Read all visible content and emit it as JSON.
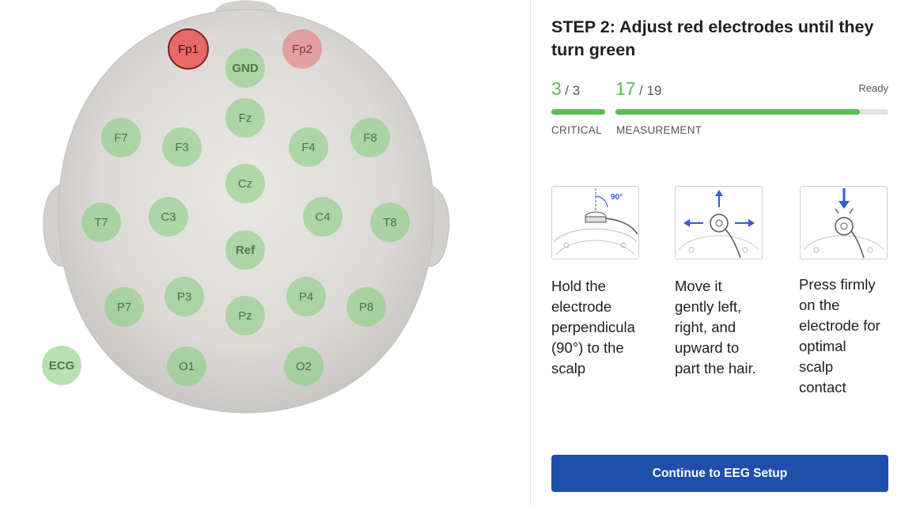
{
  "head_map": {
    "electrodes": [
      {
        "label": "Fp1",
        "state": "red",
        "bold": false
      },
      {
        "label": "Fp2",
        "state": "pink",
        "bold": false
      },
      {
        "label": "GND",
        "state": "green",
        "bold": true
      },
      {
        "label": "Fz",
        "state": "green",
        "bold": false
      },
      {
        "label": "F7",
        "state": "green",
        "bold": false
      },
      {
        "label": "F3",
        "state": "green",
        "bold": false
      },
      {
        "label": "F4",
        "state": "green",
        "bold": false
      },
      {
        "label": "F8",
        "state": "green",
        "bold": false
      },
      {
        "label": "Cz",
        "state": "green",
        "bold": false
      },
      {
        "label": "T7",
        "state": "green",
        "bold": false
      },
      {
        "label": "C3",
        "state": "green",
        "bold": false
      },
      {
        "label": "C4",
        "state": "green",
        "bold": false
      },
      {
        "label": "T8",
        "state": "green",
        "bold": false
      },
      {
        "label": "Ref",
        "state": "green",
        "bold": true
      },
      {
        "label": "P7",
        "state": "green",
        "bold": false
      },
      {
        "label": "P3",
        "state": "green",
        "bold": false
      },
      {
        "label": "Pz",
        "state": "green",
        "bold": false
      },
      {
        "label": "P4",
        "state": "green",
        "bold": false
      },
      {
        "label": "P8",
        "state": "green",
        "bold": false
      },
      {
        "label": "ECG",
        "state": "green",
        "bold": true
      },
      {
        "label": "O1",
        "state": "green",
        "bold": false
      },
      {
        "label": "O2",
        "state": "green",
        "bold": false
      }
    ]
  },
  "panel": {
    "title": "STEP 2: Adjust red electrodes until they turn green",
    "critical": {
      "value": "3",
      "total": "/ 3",
      "label": "CRITICAL",
      "fraction": 1.0
    },
    "measurement": {
      "value": "17",
      "total": "/ 19",
      "label": "MEASUREMENT",
      "fraction": 0.895
    },
    "status": "Ready",
    "steps": [
      {
        "icon": "electrode-perpendicular-icon",
        "angle_label": "90°",
        "text": "Hold the\nelectrode\nperpendicula\n(90°) to the\nscalp"
      },
      {
        "icon": "electrode-wiggle-icon",
        "text": "Move it\ngently left,\nright, and\nupward to\npart the hair."
      },
      {
        "icon": "electrode-press-icon",
        "text": "Press firmly\non the\nelectrode for\noptimal\nscalp\ncontact"
      }
    ],
    "continue_label": "Continue to EEG Setup"
  },
  "colors": {
    "green": "#5dbb58",
    "red": "#e86a66",
    "button": "#1e4fad",
    "head": "#d6d4d1"
  }
}
